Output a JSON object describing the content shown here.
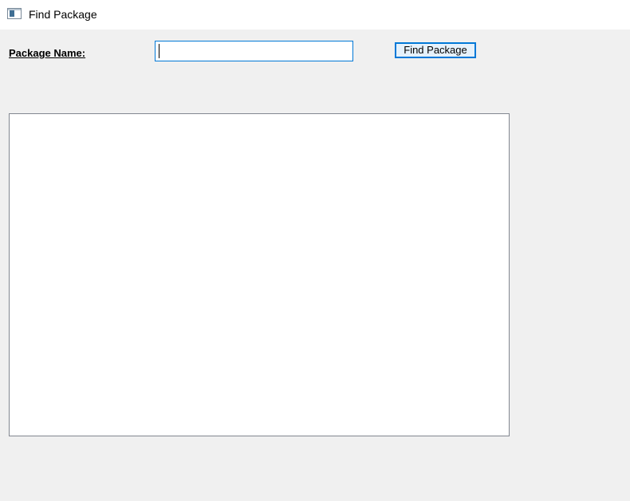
{
  "window": {
    "title": "Find Package",
    "icon": "window-app-icon"
  },
  "form": {
    "package_name_label": "Package Name:",
    "package_name_value": "",
    "package_name_placeholder": "",
    "find_button_label": "Find Package"
  },
  "results": {
    "items": []
  },
  "colors": {
    "accent": "#0078d7",
    "background": "#f0f0f0",
    "titlebar": "#ffffff"
  }
}
